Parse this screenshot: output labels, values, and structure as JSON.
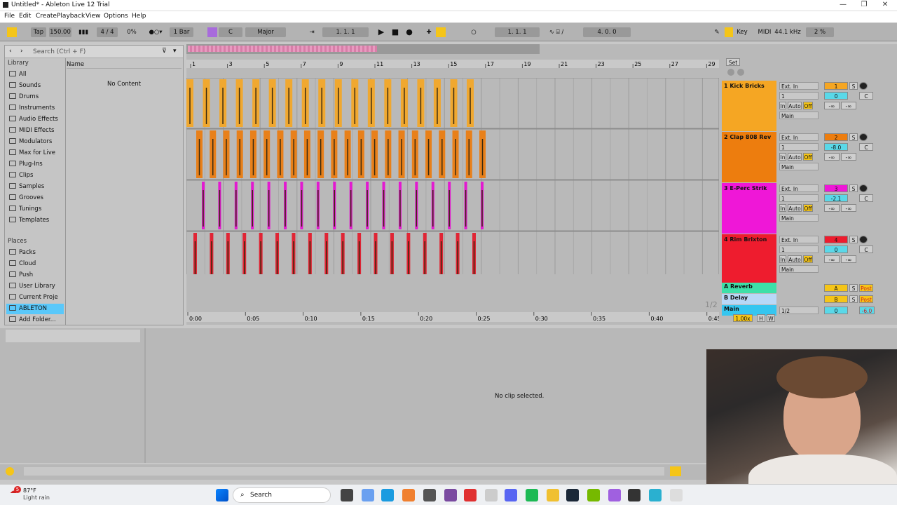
{
  "window": {
    "title": "Untitled* - Ableton Live 12 Trial"
  },
  "menu": [
    "File",
    "Edit",
    "Create",
    "Playback",
    "View",
    "Options",
    "Help"
  ],
  "toolbar": {
    "tap": "Tap",
    "tempo": "150.00",
    "signature": "4 / 4",
    "cpu_percent": "0%",
    "quantize": "1 Bar",
    "key": "C",
    "scale": "Major",
    "position": "1.   1.   1",
    "loop_start": "1.   1.   1",
    "loop_length": "4.   0.   0",
    "key_label": "Key",
    "midi_label": "MIDI",
    "sample_rate": "44.1 kHz",
    "cpu_load": "2 %"
  },
  "browser": {
    "search_placeholder": "Search (Ctrl + F)",
    "library_header": "Library",
    "name_header": "Name",
    "no_content": "No Content",
    "library_items": [
      "All",
      "Sounds",
      "Drums",
      "Instruments",
      "Audio Effects",
      "MIDI Effects",
      "Modulators",
      "Max for Live",
      "Plug-Ins",
      "Clips",
      "Samples",
      "Grooves",
      "Tunings",
      "Templates"
    ],
    "places_header": "Places",
    "places_items": [
      "Packs",
      "Cloud",
      "Push",
      "User Library",
      "Current Proje",
      "ABLETON",
      "Add Folder..."
    ]
  },
  "arrangement": {
    "bar_numbers": [
      "1",
      "3",
      "5",
      "7",
      "9",
      "11",
      "13",
      "15",
      "17",
      "19",
      "21",
      "23",
      "25",
      "27",
      "29"
    ],
    "time_labels": [
      "0:00",
      "0:05",
      "0:10",
      "0:15",
      "0:20",
      "0:25",
      "0:30",
      "0:35",
      "0:40",
      "0:45"
    ],
    "set_button": "Set",
    "page_indicator": "1/2",
    "zoom": "1.00x",
    "h_button": "H",
    "w_button": "W"
  },
  "tracks": [
    {
      "name": "1 Kick Bricks",
      "color": "#f5a623",
      "clip_color": "#f0a830",
      "input": "Ext. In",
      "channel": "1",
      "output": "Main",
      "number": "1",
      "volume": "0",
      "pan": "C",
      "send_a": "-∞",
      "send_b": "-∞"
    },
    {
      "name": "2 Clap 808 Rev",
      "color": "#ed7d0e",
      "clip_color": "#e8801a",
      "input": "Ext. In",
      "channel": "1",
      "output": "Main",
      "number": "2",
      "volume": "-8.0",
      "pan": "C",
      "send_a": "-∞",
      "send_b": "-∞"
    },
    {
      "name": "3 E-Perc Strik",
      "color": "#ef17d7",
      "clip_color": "#e21ad0",
      "input": "Ext. In",
      "channel": "1",
      "output": "Main",
      "number": "3",
      "volume": "-2.1",
      "pan": "C",
      "send_a": "-∞",
      "send_b": "-∞"
    },
    {
      "name": "4 Rim Brixton",
      "color": "#ee1c2e",
      "clip_color": "#e02535",
      "input": "Ext. In",
      "channel": "1",
      "output": "Main",
      "number": "4",
      "volume": "0",
      "pan": "C",
      "send_a": "-∞",
      "send_b": "-∞"
    }
  ],
  "track_buttons": {
    "in": "In",
    "auto": "Auto",
    "off": "Off",
    "solo": "S"
  },
  "returns": [
    {
      "name": "A Reverb",
      "color": "#3ee0a8",
      "letter": "A",
      "post": "Post"
    },
    {
      "name": "B Delay",
      "color": "#b9d8f7",
      "letter": "B",
      "post": "Post"
    }
  ],
  "main": {
    "name": "Main",
    "color": "#36c6f0",
    "routing": "1/2",
    "volume": "0",
    "level": "-6.0"
  },
  "detail": {
    "no_clip": "No clip selected."
  },
  "weather": {
    "temp": "87°F",
    "cond": "Light rain"
  },
  "taskbar": {
    "search": "Search",
    "badge": "5"
  }
}
